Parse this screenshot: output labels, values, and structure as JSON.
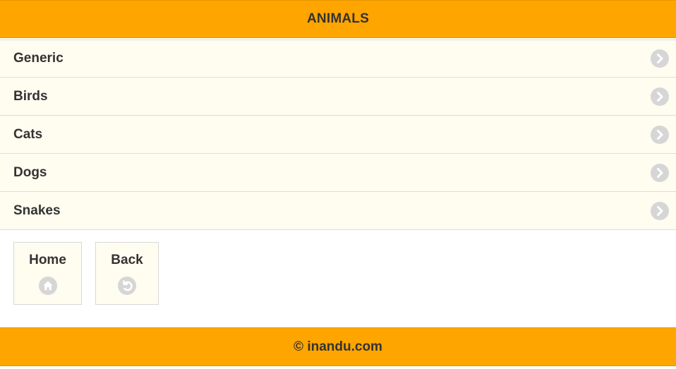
{
  "header": {
    "title": "ANIMALS"
  },
  "list": {
    "items": [
      {
        "label": "Generic",
        "icon": "chevron-right-icon"
      },
      {
        "label": "Birds",
        "icon": "chevron-right-icon"
      },
      {
        "label": "Cats",
        "icon": "chevron-right-icon"
      },
      {
        "label": "Dogs",
        "icon": "chevron-right-icon"
      },
      {
        "label": "Snakes",
        "icon": "chevron-right-icon"
      }
    ]
  },
  "buttons": {
    "home": {
      "label": "Home",
      "icon": "home-icon"
    },
    "back": {
      "label": "Back",
      "icon": "back-arrow-icon"
    }
  },
  "footer": {
    "text": "© inandu.com"
  },
  "colors": {
    "bar": "#ffa500",
    "item_bg": "#fffcf0",
    "icon_disc": "#d6d6d6",
    "text": "#333333"
  }
}
